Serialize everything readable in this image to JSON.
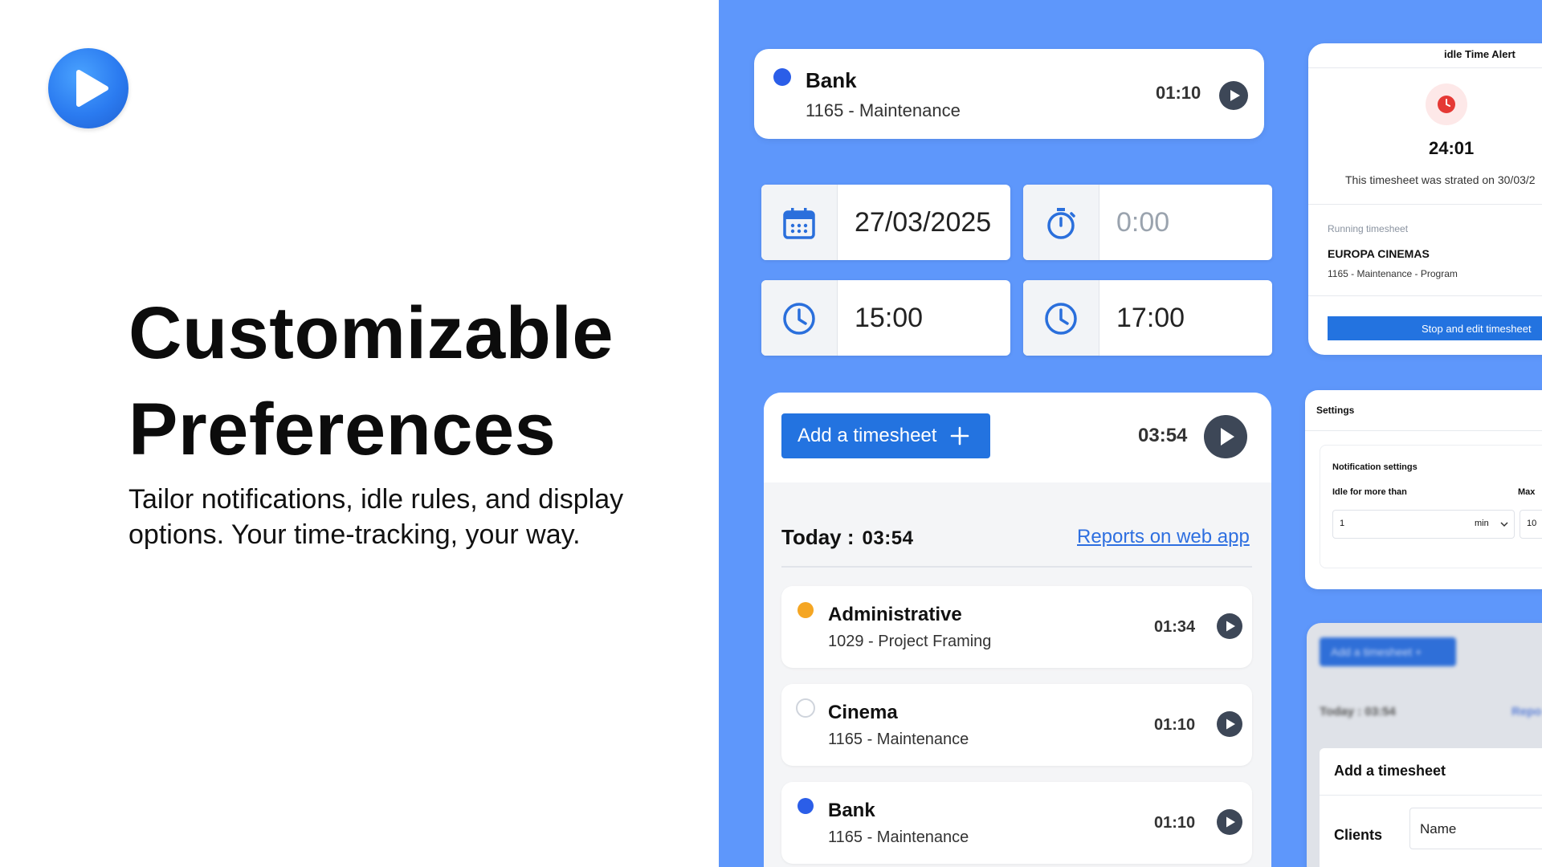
{
  "hero": {
    "title_line1": "Customizable",
    "title_line2": "Preferences",
    "subtitle": "Tailor notifications, idle rules, and display options. Your time-tracking, your way."
  },
  "colors": {
    "background_right": "#5e97fb",
    "accent_blue": "#2373e0",
    "status_blue": "#2b5ee8",
    "status_orange": "#f5a623",
    "alert_red": "#e53935",
    "play_button": "#3d4757"
  },
  "current_entry": {
    "name": "Bank",
    "subtitle": "1165 - Maintenance",
    "time": "01:10",
    "status_color": "#2b5ee8"
  },
  "fields": {
    "date": "27/03/2025",
    "duration": "0:00",
    "start_time": "15:00",
    "end_time": "17:00"
  },
  "timesheets": {
    "add_button_label": "Add a timesheet",
    "header_time": "03:54",
    "today_label": "Today :",
    "today_value": "03:54",
    "reports_link": "Reports on web app",
    "items": [
      {
        "name": "Administrative",
        "subtitle": "1029 - Project Framing",
        "time": "01:34",
        "status": "orange"
      },
      {
        "name": "Cinema",
        "subtitle": "1165 - Maintenance",
        "time": "01:10",
        "status": "empty"
      },
      {
        "name": "Bank",
        "subtitle": "1165 - Maintenance",
        "time": "01:10",
        "status": "blue"
      }
    ]
  },
  "idle_alert": {
    "title": "idle Time Alert",
    "elapsed": "24:01",
    "message": "This timesheet was strated on 30/03/2",
    "running_label": "Running timesheet",
    "running_name": "EUROPA CINEMAS",
    "running_subtitle": "1165 - Maintenance - Program",
    "stop_button": "Stop and edit timesheet"
  },
  "settings": {
    "title": "Settings",
    "section": "Notification settings",
    "idle_label": "Idle for more than",
    "idle_value": "1",
    "idle_unit": "min",
    "max_label": "Max",
    "max_value": "10"
  },
  "add_form": {
    "bg_button": "Add a timesheet +",
    "bg_today": "Today :  03:54",
    "bg_reports": "Repo",
    "title": "Add a timesheet",
    "clients_label": "Clients",
    "name_placeholder": "Name"
  },
  "icons": {
    "logo": "play-logo-icon",
    "calendar": "calendar-icon",
    "stopwatch": "stopwatch-icon",
    "clock": "clock-icon",
    "play": "play-icon",
    "plus": "plus-icon",
    "alert_clock": "alert-clock-icon",
    "chevron": "chevron-down-icon"
  }
}
